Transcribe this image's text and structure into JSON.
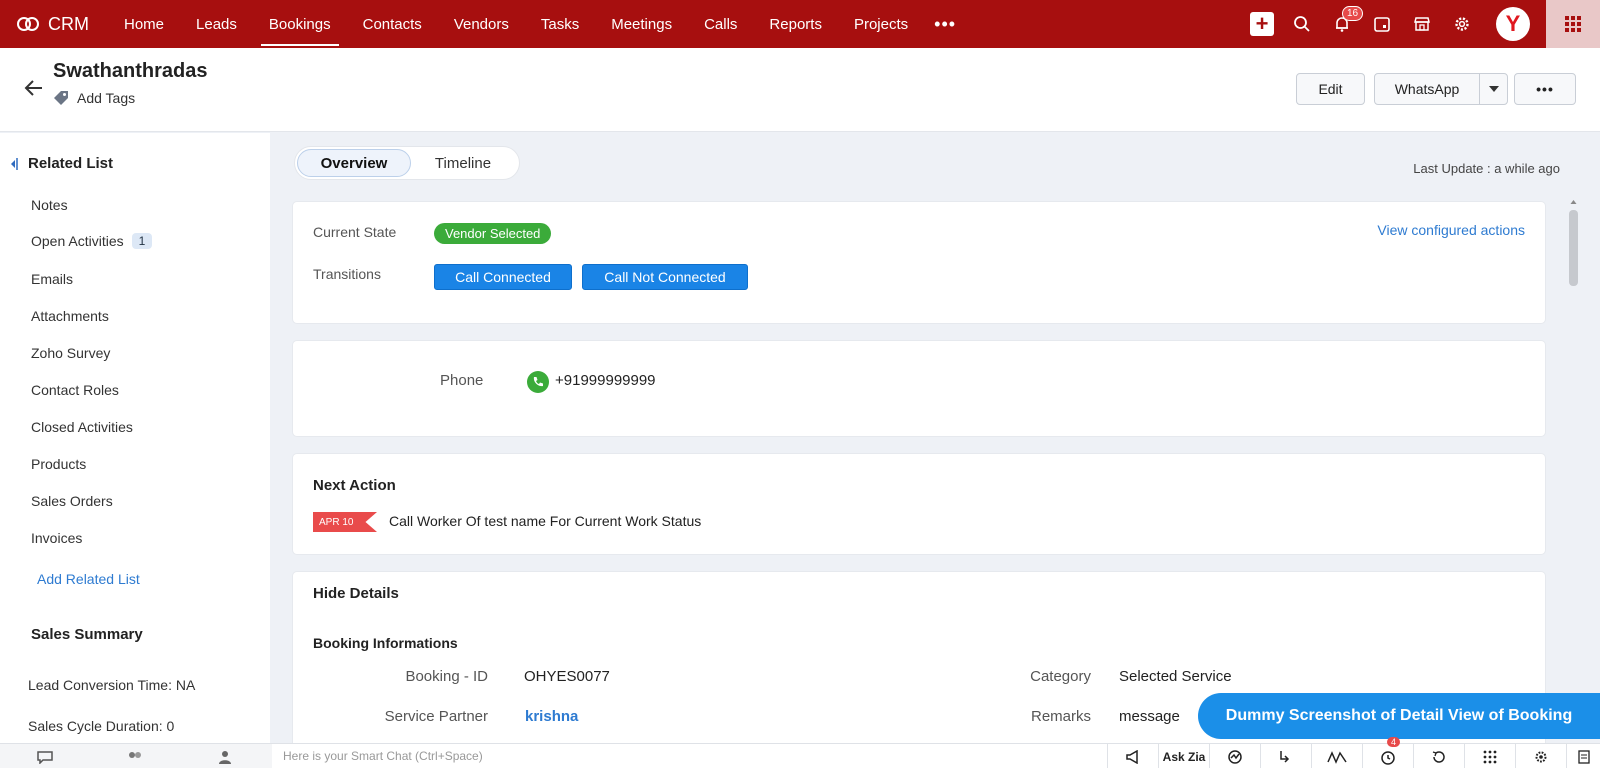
{
  "app": {
    "name": "CRM"
  },
  "nav": {
    "tabs": [
      "Home",
      "Leads",
      "Bookings",
      "Contacts",
      "Vendors",
      "Tasks",
      "Meetings",
      "Calls",
      "Reports",
      "Projects"
    ],
    "more": "•••",
    "notification_count": "16",
    "avatar_letter": "Y"
  },
  "record": {
    "name": "Swathanthradas",
    "add_tags": "Add Tags",
    "edit_label": "Edit",
    "whatsapp_label": "WhatsApp",
    "more_label": "•••"
  },
  "sidebar": {
    "related_list_title": "Related List",
    "items": [
      {
        "label": "Notes"
      },
      {
        "label": "Open Activities",
        "count": "1"
      },
      {
        "label": "Emails"
      },
      {
        "label": "Attachments"
      },
      {
        "label": "Zoho Survey"
      },
      {
        "label": "Contact Roles"
      },
      {
        "label": "Closed Activities"
      },
      {
        "label": "Products"
      },
      {
        "label": "Sales Orders"
      },
      {
        "label": "Invoices"
      }
    ],
    "add_related_list": "Add Related List",
    "sales_summary_title": "Sales Summary",
    "summary": [
      "Lead Conversion Time: NA",
      "Sales Cycle Duration: 0"
    ]
  },
  "view_tabs": {
    "overview": "Overview",
    "timeline": "Timeline"
  },
  "last_update": "Last Update : a while ago",
  "blueprint": {
    "current_state_label": "Current State",
    "current_state": "Vendor Selected",
    "transitions_label": "Transitions",
    "transitions": [
      "Call Connected",
      "Call Not Connected"
    ],
    "view_actions": "View configured actions"
  },
  "contact": {
    "phone_label": "Phone",
    "phone": "+91999999999"
  },
  "next_action": {
    "title": "Next Action",
    "date": "APR 10",
    "text": "Call Worker Of test name For Current Work Status"
  },
  "details": {
    "hide_label": "Hide Details",
    "section_title": "Booking Informations",
    "booking_id_label": "Booking - ID",
    "booking_id": "OHYES0077",
    "category_label": "Category",
    "category": "Selected Service",
    "partner_label": "Service Partner",
    "partner": "krishna",
    "remarks_label": "Remarks",
    "remarks": "message"
  },
  "watermark": "Dummy Screenshot of  Detail View of Booking",
  "bottom": {
    "smart_chat": "Here is your Smart Chat (Ctrl+Space)",
    "ask_zia": "Ask Zia",
    "reminder_count": "4"
  },
  "colors": {
    "nav_bg": "#a70f0f",
    "state_green": "#3bab3a",
    "transition_blue": "#1a84e6",
    "link_blue": "#2e7bd1",
    "tag_red": "#e94b4b"
  }
}
